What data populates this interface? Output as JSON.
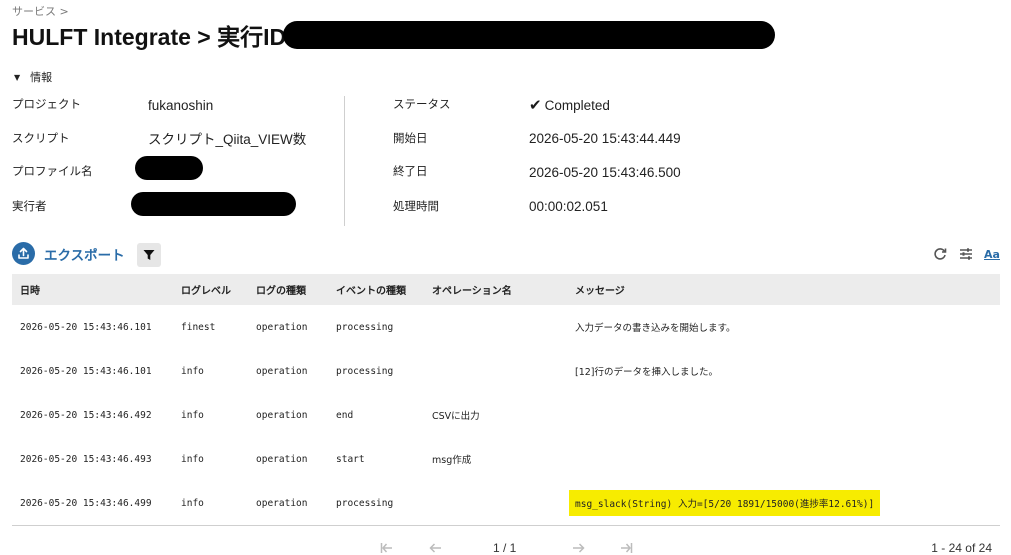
{
  "breadcrumb": "サービス >",
  "header": {
    "title": "HULFT Integrate > 実行ID"
  },
  "info_section": {
    "toggle_label": "情報",
    "left": [
      {
        "label": "プロジェクト",
        "value": "fukanoshin"
      },
      {
        "label": "スクリプト",
        "value": "スクリプト_Qiita_VIEW数"
      },
      {
        "label": "プロファイル名",
        "value": ""
      },
      {
        "label": "実行者",
        "value": ""
      }
    ],
    "right": [
      {
        "label": "ステータス",
        "value": "Completed"
      },
      {
        "label": "開始日",
        "value": "2026-05-20 15:43:44.449"
      },
      {
        "label": "終了日",
        "value": "2026-05-20 15:43:46.500"
      },
      {
        "label": "処理時間",
        "value": "00:00:02.051"
      }
    ]
  },
  "toolbar": {
    "export_label": "エクスポート",
    "text_size_label": "Aa"
  },
  "table": {
    "columns": [
      "日時",
      "ログレベル",
      "ログの種類",
      "イベントの種類",
      "オペレーション名",
      "メッセージ"
    ],
    "rows": [
      [
        "2026-05-20 15:43:46.101",
        "finest",
        "operation",
        "processing",
        "",
        "入力データの書き込みを開始します。"
      ],
      [
        "2026-05-20 15:43:46.101",
        "info",
        "operation",
        "processing",
        "",
        "[12]行のデータを挿入しました。"
      ],
      [
        "2026-05-20 15:43:46.492",
        "info",
        "operation",
        "end",
        "CSVに出力",
        ""
      ],
      [
        "2026-05-20 15:43:46.493",
        "info",
        "operation",
        "start",
        "msg作成",
        ""
      ],
      [
        "2026-05-20 15:43:46.499",
        "info",
        "operation",
        "processing",
        "",
        "msg_slack(String) 入力=[5/20  1891/15000(進捗率12.61%)]"
      ]
    ]
  },
  "pagination": {
    "page_indicator": "1 / 1",
    "range": "1 - 24 of 24"
  },
  "colors": {
    "accent": "#2a6ca8",
    "highlight": "#f7ec00",
    "header_bg": "#ececec"
  }
}
